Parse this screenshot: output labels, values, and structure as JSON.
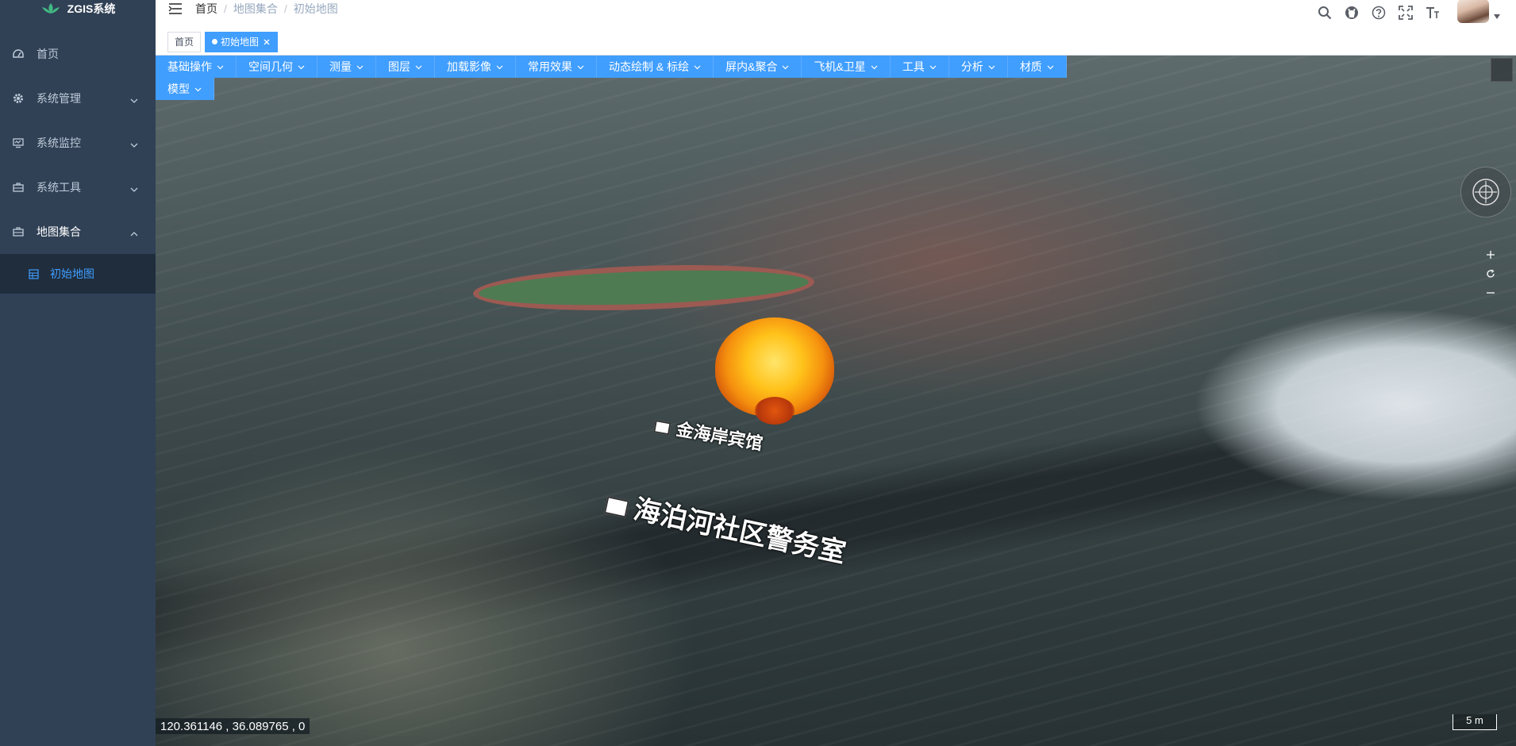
{
  "app": {
    "title": "ZGIS系统"
  },
  "sidebar": {
    "items": [
      {
        "label": "首页",
        "icon": "dashboard-icon"
      },
      {
        "label": "系统管理",
        "icon": "gear-icon"
      },
      {
        "label": "系统监控",
        "icon": "monitor-icon"
      },
      {
        "label": "系统工具",
        "icon": "toolbox-icon"
      },
      {
        "label": "地图集合",
        "icon": "toolbox-icon",
        "expanded": true
      }
    ],
    "submenu": [
      {
        "label": "初始地图",
        "icon": "grid-icon",
        "active": true
      }
    ]
  },
  "navbar": {
    "breadcrumb": [
      "首页",
      "地图集合",
      "初始地图"
    ],
    "icons": [
      "search-icon",
      "github-icon",
      "question-icon",
      "fullscreen-icon",
      "font-size-icon"
    ]
  },
  "tags": [
    {
      "label": "首页",
      "active": false
    },
    {
      "label": "初始地图",
      "active": true
    }
  ],
  "toolbar": {
    "items": [
      "基础操作",
      "空间几何",
      "测量",
      "图层",
      "加载影像",
      "常用效果",
      "动态绘制 & 标绘",
      "屏内&聚合",
      "飞机&卫星",
      "工具",
      "分析",
      "材质",
      "模型"
    ]
  },
  "map": {
    "labels": {
      "hotel": "金海岸宾馆",
      "police": "海泊河社区警务室"
    },
    "coords": "120.361146 ,   36.089765 ,   0",
    "scale": "5 m"
  },
  "colors": {
    "sidebar_bg": "#304156",
    "accent": "#409eff",
    "active_tag": "#409eff",
    "submenu_bg": "#1f2d3d"
  }
}
